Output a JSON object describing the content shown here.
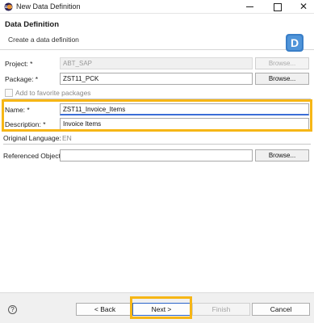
{
  "window": {
    "title": "New Data Definition",
    "close_glyph": "✕"
  },
  "header": {
    "title": "Data Definition",
    "subtitle": "Create a data definition",
    "wizard_icon": "D"
  },
  "form": {
    "project": {
      "label": "Project: *",
      "value": "ABT_SAP",
      "browse": "Browse..."
    },
    "package": {
      "label": "Package: *",
      "value": "ZST11_PCK",
      "browse": "Browse..."
    },
    "favorites": {
      "label": "Add to favorite packages",
      "checked": false
    },
    "name": {
      "label": "Name: *",
      "value": "ZST11_Invoice_Items"
    },
    "description": {
      "label": "Description: *",
      "value": "Invoice Items"
    },
    "original_language": {
      "label": "Original Language:",
      "value": "EN"
    },
    "referenced_object": {
      "label": "Referenced Object:",
      "value": "",
      "browse": "Browse..."
    }
  },
  "footer": {
    "help": "?",
    "back": "< Back",
    "next": "Next >",
    "finish": "Finish",
    "cancel": "Cancel"
  },
  "colors": {
    "highlight": "#f6b616",
    "accent": "#3b6dd6"
  }
}
